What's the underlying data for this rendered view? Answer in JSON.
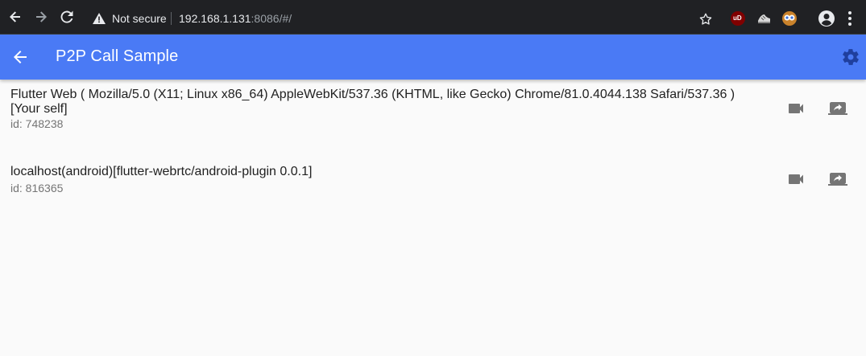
{
  "browser": {
    "security_label": "Not secure",
    "url_host": "192.168.1.131",
    "url_rest": ":8086/#/"
  },
  "app_bar": {
    "title": "P2P Call Sample"
  },
  "peers": [
    {
      "title": "Flutter Web ( Mozilla/5.0 (X11; Linux x86_64) AppleWebKit/537.36 (KHTML, like Gecko) Chrome/81.0.4044.138 Safari/537.36 )\n[Your self]",
      "subtitle": "id: 748238"
    },
    {
      "title": "localhost(android)[flutter-webrtc/android-plugin 0.0.1]",
      "subtitle": "id: 816365"
    }
  ],
  "colors": {
    "app_bar": "#4a7af5",
    "browser_bg": "#202124",
    "page_bg": "#fafafa",
    "icon_grey": "#757575"
  }
}
